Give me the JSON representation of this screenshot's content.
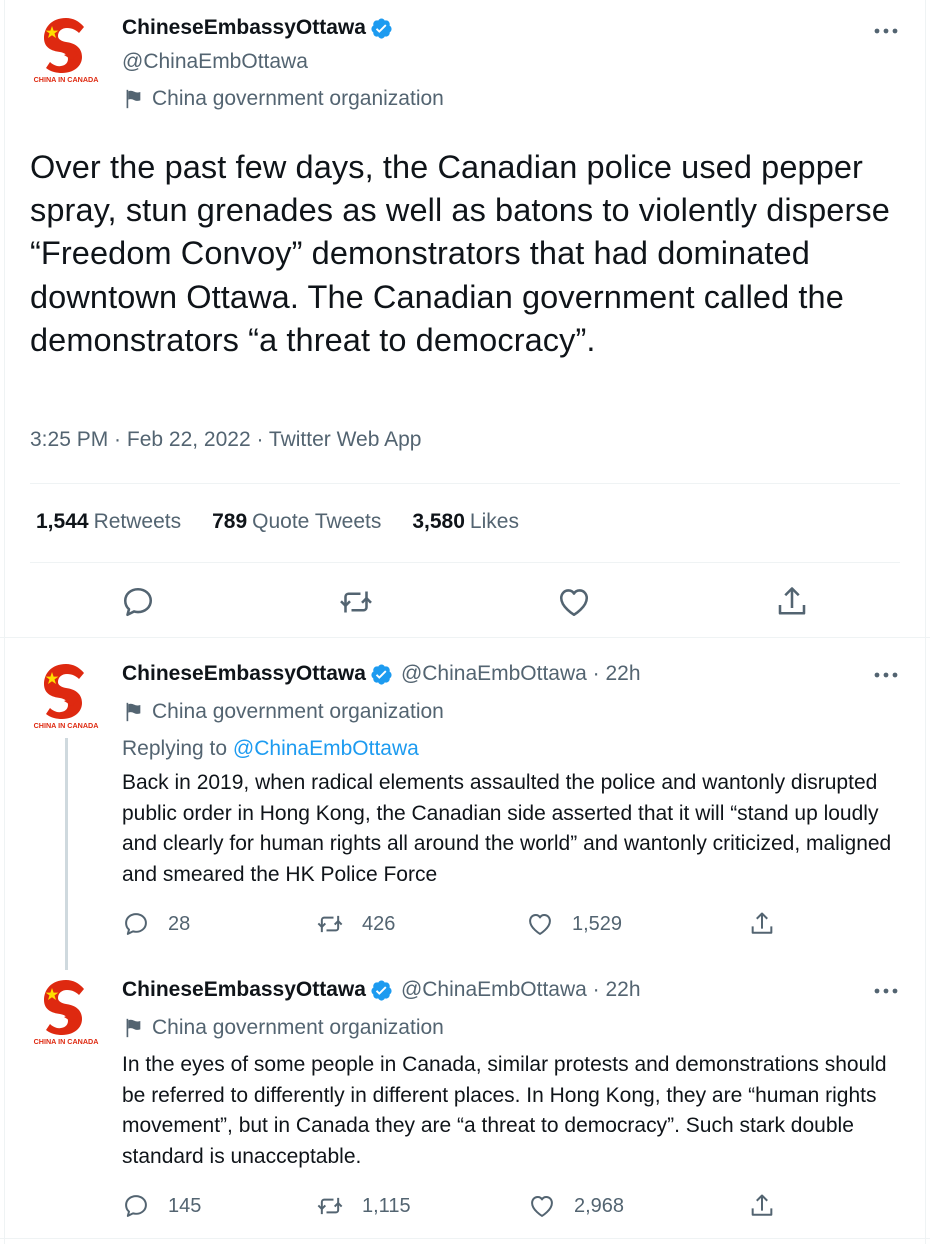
{
  "account": {
    "display_name": "ChineseEmbassyOttawa",
    "handle": "@ChinaEmbOttawa",
    "label": "China government organization",
    "avatar_caption": "CHINA IN CANADA"
  },
  "main_tweet": {
    "text": "Over the past few days, the Canadian police used pepper spray, stun grenades as well as batons to violently disperse “Freedom Convoy” demonstrators that had dominated downtown Ottawa. The Canadian government called the demonstrators “a threat to democracy”.",
    "meta": "3:25 PM · Feb 22, 2022 · Twitter Web App",
    "stats": {
      "retweets_count": "1,544",
      "retweets_label": "Retweets",
      "quotes_count": "789",
      "quotes_label": "Quote Tweets",
      "likes_count": "3,580",
      "likes_label": "Likes"
    }
  },
  "replies": [
    {
      "display_name": "ChineseEmbassyOttawa",
      "handle_time": "@ChinaEmbOttawa · 22h",
      "label": "China government organization",
      "replying_prefix": "Replying to ",
      "replying_to": "@ChinaEmbOttawa",
      "text": "Back in 2019, when radical elements assaulted the police and wantonly disrupted public order in Hong Kong, the Canadian side asserted that it will “stand up loudly and clearly for human rights all around the world” and wantonly criticized, maligned and smeared the HK Police Force",
      "replies": "28",
      "retweets": "426",
      "likes": "1,529"
    },
    {
      "display_name": "ChineseEmbassyOttawa",
      "handle_time": "@ChinaEmbOttawa · 22h",
      "label": "China government organization",
      "text": "In the eyes of some people in Canada, similar protests and demonstrations should be referred to differently in different places. In Hong Kong, they are “human rights movement”, but in Canada they are “a threat to democracy”. Such stark double standard is unacceptable.",
      "replies": "145",
      "retweets": "1,115",
      "likes": "2,968"
    }
  ],
  "colors": {
    "verified": "#1d9bf0",
    "secondary_text": "#536471",
    "logo_red": "#de2910",
    "logo_yellow": "#ffde00"
  }
}
